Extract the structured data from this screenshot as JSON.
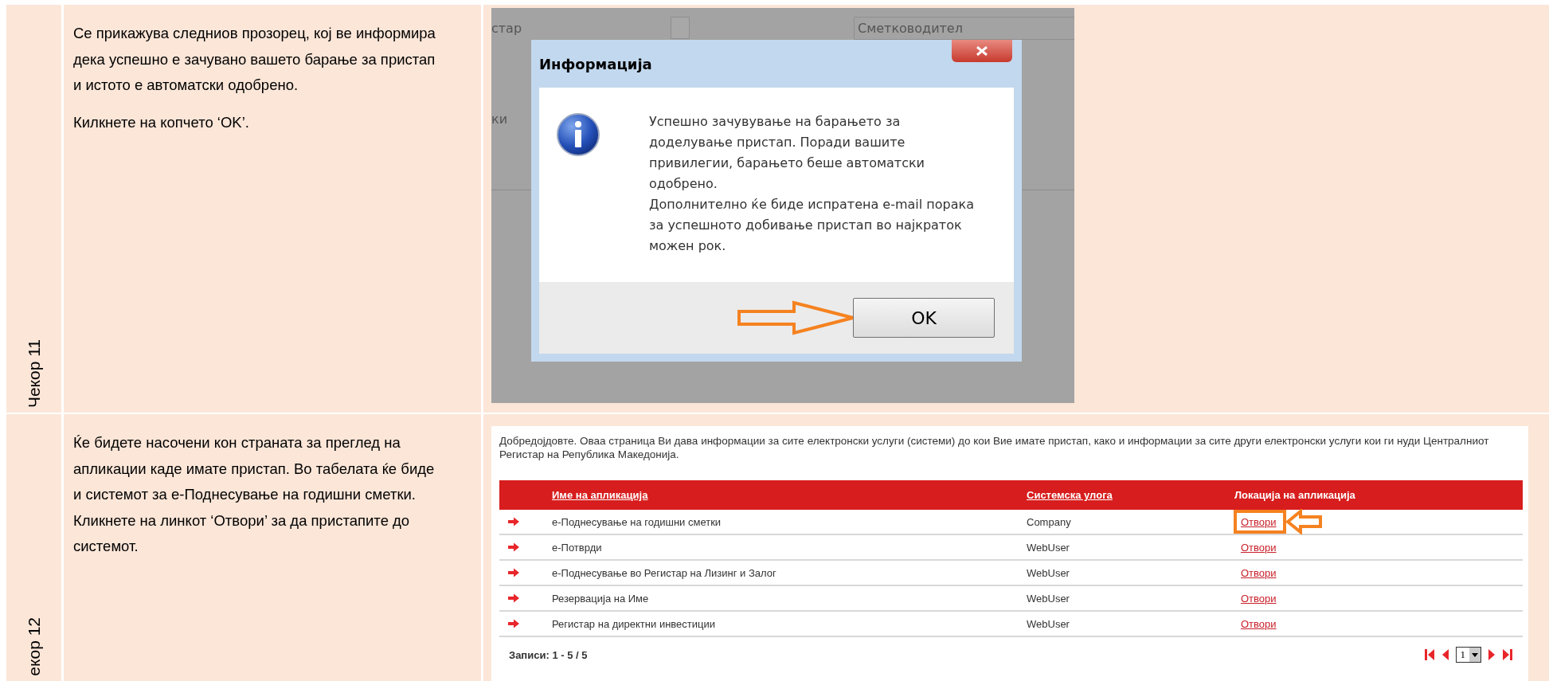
{
  "steps": [
    {
      "label": "Чекор 11",
      "paragraphs": [
        "Се прикажува следниов прозорец, кој ве информира дека успешно е зачувано вашето барање за пристап и истото е автоматски одобрено.",
        "Килкнете на копчето ‘OK’."
      ],
      "screenshot": {
        "kind": "dialog",
        "background": {
          "field_1": "стар",
          "field_2": "Сметководител",
          "label": "ки"
        },
        "dialog": {
          "title": "Информација",
          "message": [
            "Успешно зачувување на барањето за доделување пристап. Поради вашите привилегии, барањето беше автоматски одобрено.",
            "Дополнително ќе биде испратена е-mail порака за успешното добивање пристап во најкраток можен рок."
          ],
          "buttons": [
            {
              "label": "OK",
              "highlighted": true
            }
          ]
        }
      }
    },
    {
      "label": "екор 12",
      "paragraphs": [
        "Ќе бидете насочени кон страната за преглед на апликации каде имате пристап. Во табелата ќе биде и системот за е-Поднесување на годишни сметки. Кликнете на линкот ‘Отвори’ за да пристапите до системот."
      ],
      "screenshot": {
        "kind": "application_list",
        "intro": "Добредојдовте. Оваа страница Ви дава информации за сите електронски услуги (системи) до кои Вие имате пристап, како и информации за сите други електронски услуги кои ги нуди Централниот Регистар на Република Македонија.",
        "columns": [
          {
            "label": "Име на апликација",
            "sortable": true
          },
          {
            "label": "Системска улога",
            "sortable": true
          },
          {
            "label": "Локација на апликација",
            "sortable": false
          }
        ],
        "rows": [
          {
            "name": "е-Поднесување на годишни сметки",
            "role": "Company",
            "link": "Отвори",
            "highlighted": true
          },
          {
            "name": "е-Потврди",
            "role": "WebUser",
            "link": "Отвори",
            "highlighted": false
          },
          {
            "name": "е-Поднесување во Регистар на Лизинг и Залог",
            "role": "WebUser",
            "link": "Отвори",
            "highlighted": false
          },
          {
            "name": "Резервација на Име",
            "role": "WebUser",
            "link": "Отвори",
            "highlighted": false
          },
          {
            "name": "Регистар на директни инвестиции",
            "role": "WebUser",
            "link": "Отвори",
            "highlighted": false
          }
        ],
        "records": "Записи: 1 - 5 / 5",
        "page": "1"
      }
    }
  ]
}
